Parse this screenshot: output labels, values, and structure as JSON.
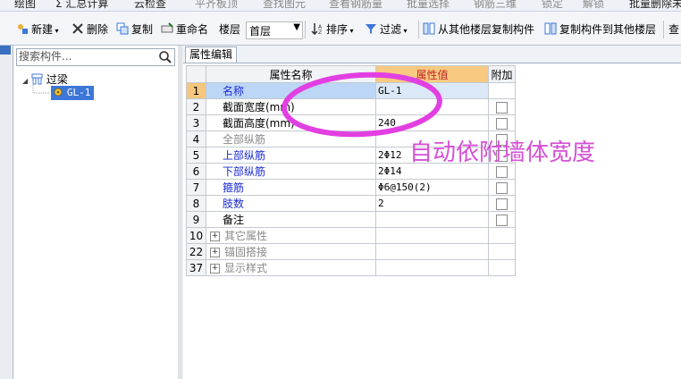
{
  "topbar": {
    "items": [
      "绘图",
      "Σ 汇总计算",
      "云检查",
      "平齐板顶",
      "查找图元",
      "查看钢筋量",
      "批量选择",
      "钢筋三维",
      "锁定",
      "解锁",
      "批量删除未"
    ]
  },
  "toolbar": {
    "new_label": "新建",
    "delete_label": "删除",
    "copy_label": "复制",
    "rename_label": "重命名",
    "floor_label": "楼层",
    "floor_value": "首层",
    "sort_label": "排序",
    "filter_label": "过滤",
    "copy_from_label": "从其他楼层复制构件",
    "copy_to_label": "复制构件到其他楼层",
    "cut_label": "查"
  },
  "left": {
    "search_placeholder": "搜索构件...",
    "tree_root": "过梁",
    "tree_child": "GL-1"
  },
  "right": {
    "tab_label": "属性编辑",
    "headers": {
      "name": "属性名称",
      "value": "属性值",
      "extra": "附加"
    },
    "rows": [
      {
        "num": "1",
        "name": "名称",
        "value": "GL-1",
        "style": "selrow",
        "checkbox": false,
        "expander": false
      },
      {
        "num": "2",
        "name": "截面宽度(mm)",
        "value": "",
        "style": "",
        "checkbox": true,
        "expander": false
      },
      {
        "num": "3",
        "name": "截面高度(mm)",
        "value": "240",
        "style": "",
        "checkbox": true,
        "expander": false
      },
      {
        "num": "4",
        "name": "全部纵筋",
        "value": "",
        "style": "gray",
        "checkbox": true,
        "expander": false
      },
      {
        "num": "5",
        "name": "上部纵筋",
        "value": "2Φ12",
        "style": "blue",
        "checkbox": true,
        "expander": false
      },
      {
        "num": "6",
        "name": "下部纵筋",
        "value": "2Φ14",
        "style": "blue",
        "checkbox": true,
        "expander": false
      },
      {
        "num": "7",
        "name": "箍筋",
        "value": "Φ6@150(2)",
        "style": "blue",
        "checkbox": true,
        "expander": false
      },
      {
        "num": "8",
        "name": "肢数",
        "value": "2",
        "style": "blue",
        "checkbox": true,
        "expander": false
      },
      {
        "num": "9",
        "name": "备注",
        "value": "",
        "style": "",
        "checkbox": true,
        "expander": false
      },
      {
        "num": "10",
        "name": "其它属性",
        "value": "",
        "style": "gray",
        "checkbox": false,
        "expander": true
      },
      {
        "num": "22",
        "name": "锚固搭接",
        "value": "",
        "style": "gray",
        "checkbox": false,
        "expander": true
      },
      {
        "num": "37",
        "name": "显示样式",
        "value": "",
        "style": "gray",
        "checkbox": false,
        "expander": true
      }
    ]
  },
  "annotation": {
    "text": "自动依附墙体宽度",
    "color": "#d64fd6"
  },
  "colors": {
    "accent": "#3c77d9",
    "header_value": "#f7c981",
    "blue_text": "#1a2ad0"
  }
}
